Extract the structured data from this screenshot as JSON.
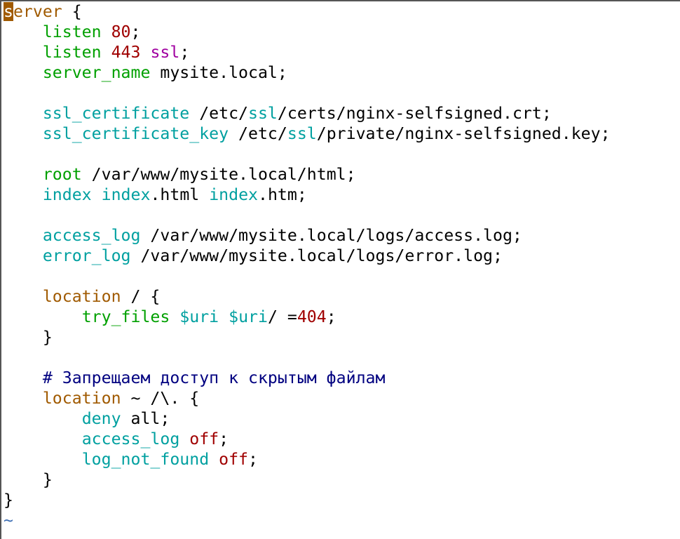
{
  "editor": {
    "colors": {
      "background": "#ffffff",
      "text": "#000000",
      "keyword_brown": "#a05a00",
      "directive_green": "#00a000",
      "directive_cyan": "#00a0a0",
      "number_red": "#a00000",
      "ssl_magenta": "#a000a0",
      "comment_blue": "#000080",
      "tilde_blue": "#3c6eb4",
      "cursor_bg": "#a05a00"
    },
    "cursor": {
      "line": 1,
      "col": 1
    },
    "lines": [
      [
        {
          "t": "s",
          "c": "cursor"
        },
        {
          "t": "erver",
          "c": "keyword_brown"
        },
        {
          "t": " {",
          "c": "text"
        }
      ],
      [
        {
          "t": "    ",
          "c": "text"
        },
        {
          "t": "listen",
          "c": "directive_green"
        },
        {
          "t": " ",
          "c": "text"
        },
        {
          "t": "80",
          "c": "number_red"
        },
        {
          "t": ";",
          "c": "text"
        }
      ],
      [
        {
          "t": "    ",
          "c": "text"
        },
        {
          "t": "listen",
          "c": "directive_green"
        },
        {
          "t": " ",
          "c": "text"
        },
        {
          "t": "443",
          "c": "number_red"
        },
        {
          "t": " ",
          "c": "text"
        },
        {
          "t": "ssl",
          "c": "ssl_magenta"
        },
        {
          "t": ";",
          "c": "text"
        }
      ],
      [
        {
          "t": "    ",
          "c": "text"
        },
        {
          "t": "server_name",
          "c": "directive_green"
        },
        {
          "t": " mysite.local;",
          "c": "text"
        }
      ],
      [],
      [
        {
          "t": "    ",
          "c": "text"
        },
        {
          "t": "ssl_certificate",
          "c": "directive_cyan"
        },
        {
          "t": " /etc/",
          "c": "text"
        },
        {
          "t": "ssl",
          "c": "directive_cyan"
        },
        {
          "t": "/certs/nginx-selfsigned.crt;",
          "c": "text"
        }
      ],
      [
        {
          "t": "    ",
          "c": "text"
        },
        {
          "t": "ssl_certificate_key",
          "c": "directive_cyan"
        },
        {
          "t": " /etc/",
          "c": "text"
        },
        {
          "t": "ssl",
          "c": "directive_cyan"
        },
        {
          "t": "/private/nginx-selfsigned.key;",
          "c": "text"
        }
      ],
      [],
      [
        {
          "t": "    ",
          "c": "text"
        },
        {
          "t": "root",
          "c": "directive_green"
        },
        {
          "t": " /var/www/mysite.local/html;",
          "c": "text"
        }
      ],
      [
        {
          "t": "    ",
          "c": "text"
        },
        {
          "t": "index",
          "c": "directive_cyan"
        },
        {
          "t": " ",
          "c": "text"
        },
        {
          "t": "index",
          "c": "directive_cyan"
        },
        {
          "t": ".html ",
          "c": "text"
        },
        {
          "t": "index",
          "c": "directive_cyan"
        },
        {
          "t": ".htm;",
          "c": "text"
        }
      ],
      [],
      [
        {
          "t": "    ",
          "c": "text"
        },
        {
          "t": "access_log",
          "c": "directive_cyan"
        },
        {
          "t": " /var/www/mysite.local/logs/access.log;",
          "c": "text"
        }
      ],
      [
        {
          "t": "    ",
          "c": "text"
        },
        {
          "t": "error_log",
          "c": "directive_cyan"
        },
        {
          "t": " /var/www/mysite.local/logs/error.log;",
          "c": "text"
        }
      ],
      [],
      [
        {
          "t": "    ",
          "c": "text"
        },
        {
          "t": "location",
          "c": "keyword_brown"
        },
        {
          "t": " / {",
          "c": "text"
        }
      ],
      [
        {
          "t": "        ",
          "c": "text"
        },
        {
          "t": "try_files",
          "c": "directive_green"
        },
        {
          "t": " ",
          "c": "text"
        },
        {
          "t": "$uri",
          "c": "directive_cyan"
        },
        {
          "t": " ",
          "c": "text"
        },
        {
          "t": "$uri",
          "c": "directive_cyan"
        },
        {
          "t": "/ =",
          "c": "text"
        },
        {
          "t": "404",
          "c": "number_red"
        },
        {
          "t": ";",
          "c": "text"
        }
      ],
      [
        {
          "t": "    }",
          "c": "text"
        }
      ],
      [],
      [
        {
          "t": "    ",
          "c": "text"
        },
        {
          "t": "# Запрещаем доступ к скрытым файлам",
          "c": "comment_blue"
        }
      ],
      [
        {
          "t": "    ",
          "c": "text"
        },
        {
          "t": "location",
          "c": "keyword_brown"
        },
        {
          "t": " ~ /\\. {",
          "c": "text"
        }
      ],
      [
        {
          "t": "        ",
          "c": "text"
        },
        {
          "t": "deny",
          "c": "directive_cyan"
        },
        {
          "t": " all;",
          "c": "text"
        }
      ],
      [
        {
          "t": "        ",
          "c": "text"
        },
        {
          "t": "access_log",
          "c": "directive_cyan"
        },
        {
          "t": " ",
          "c": "text"
        },
        {
          "t": "off",
          "c": "number_red"
        },
        {
          "t": ";",
          "c": "text"
        }
      ],
      [
        {
          "t": "        ",
          "c": "text"
        },
        {
          "t": "log_not_found",
          "c": "directive_cyan"
        },
        {
          "t": " ",
          "c": "text"
        },
        {
          "t": "off",
          "c": "number_red"
        },
        {
          "t": ";",
          "c": "text"
        }
      ],
      [
        {
          "t": "    }",
          "c": "text"
        }
      ],
      [
        {
          "t": "}",
          "c": "text"
        }
      ],
      [
        {
          "t": "~",
          "c": "tilde_blue"
        }
      ]
    ]
  }
}
